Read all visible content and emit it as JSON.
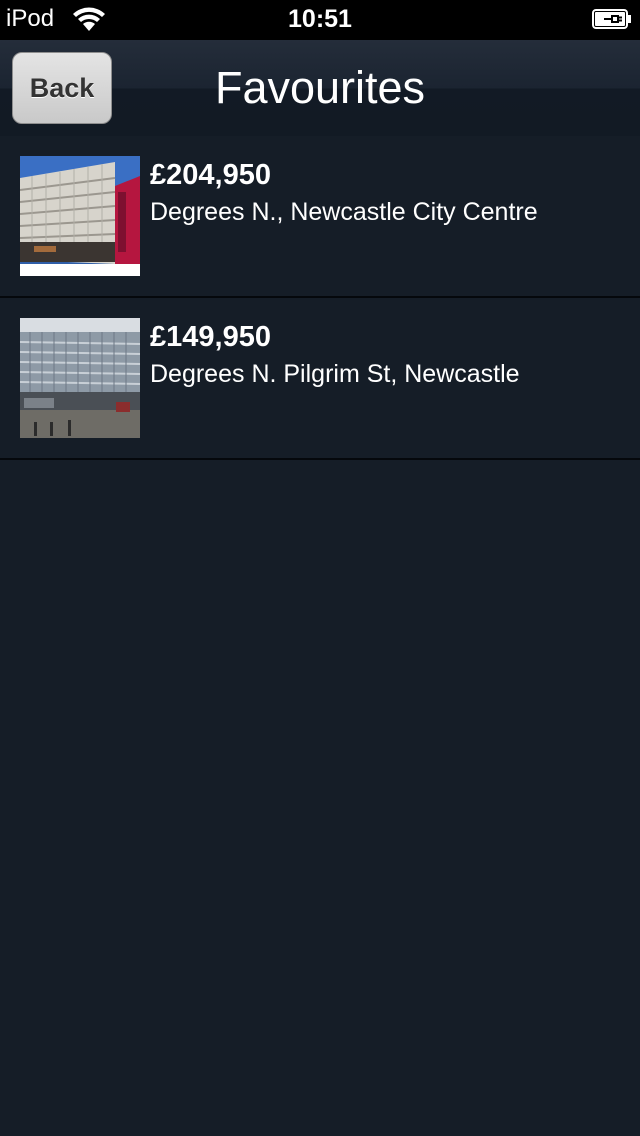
{
  "status_bar": {
    "carrier": "iPod",
    "time": "10:51"
  },
  "nav": {
    "back_label": "Back",
    "title": "Favourites"
  },
  "favourites": [
    {
      "price": "£204,950",
      "address": "Degrees N., Newcastle City Centre"
    },
    {
      "price": "£149,950",
      "address": "Degrees N. Pilgrim St, Newcastle"
    }
  ],
  "colors": {
    "background": "#151d27",
    "status_bar": "#000000",
    "text": "#ffffff",
    "back_button": "#d6d6d6"
  }
}
